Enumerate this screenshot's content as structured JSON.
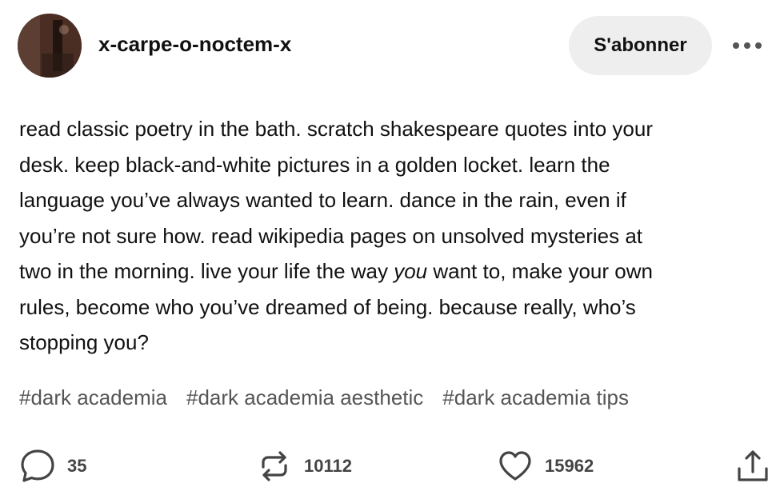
{
  "post": {
    "blog_name": "x-carpe-o-noctem-x",
    "follow_label": "S'abonner",
    "body_lines": [
      "read classic poetry in the bath.  scratch shakespeare quotes into your",
      "desk.  keep black-and-white pictures in a golden locket.  learn the",
      "language you’ve always wanted to learn.  dance in the rain, even if",
      "you’re not sure how.  read wikipedia pages on unsolved mysteries at"
    ],
    "body_line5_before": "two in the morning.  live your life the way ",
    "body_line5_emph": "you",
    "body_line5_after": " want to, make your own",
    "body_line6": "rules, become who you’ve dreamed of being.  because really, who’s",
    "body_line7": "stopping you?",
    "tags": [
      "#dark academia",
      "#dark academia aesthetic",
      "#dark academia tips"
    ]
  },
  "footer": {
    "comments": "35",
    "reblogs": "10112",
    "likes": "15962",
    "icons": {
      "comment": "comment-icon",
      "reblog": "reblog-icon",
      "like": "heart-icon",
      "share": "share-icon"
    }
  },
  "colors": {
    "text": "#111111",
    "tag_text": "#555555",
    "follow_bg": "#eeeeee",
    "icon": "#444444"
  }
}
